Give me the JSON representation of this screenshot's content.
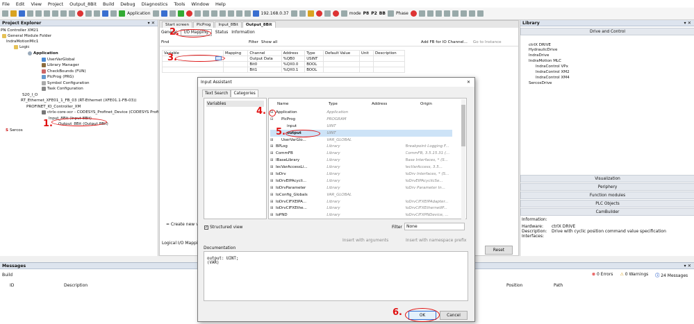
{
  "menu": [
    "File",
    "Edit",
    "View",
    "Project",
    "Output_8Bit",
    "Build",
    "Debug",
    "Diagnostics",
    "Tools",
    "Window",
    "Help"
  ],
  "toolbar": {
    "application": "Application",
    "ip": "192.168.0.37",
    "mode": "mode",
    "p8": "P8",
    "p2": "P2",
    "bb": "BB",
    "phase": "Phase"
  },
  "project_explorer": {
    "title": "Project Explorer",
    "items": [
      "PN Controller XM21",
      "General Module Folder",
      "IndraMotionMlc1",
      "Logic",
      "Application",
      "UserVarGlobal",
      "Library Manager",
      "CheckBounds (FUN)",
      "PlcProg (PRG)",
      "Symbol Configuration",
      "Task Configuration",
      "S20_I_O",
      "RT_Ethernet_XFE01_1_FB_03 (RT-Ethernet (XFE01.1-FB-03))",
      "PROFINET_IO_Controller_XM",
      "ctrlx-core-xcr - CODESYS_Profinet_Device (CODESYS Profinet",
      "Input_8Bit (Input 8Bit)",
      "Output_8Bit (Output 8Bit)",
      "Sercos"
    ]
  },
  "editor": {
    "tabs": [
      "Start screen",
      "PlcProg",
      "Input_8Bit",
      "Output_8Bit"
    ],
    "subtabs": [
      "General",
      "I/O Mapping",
      "Status",
      "Information"
    ],
    "find": "Find",
    "filter_label": "Filter",
    "filter_value": "Show all",
    "add_fb": "Add FB for IO Channel...",
    "goto": "Go to Instance",
    "columns": [
      "Variable",
      "Mapping",
      "Channel",
      "Address",
      "Type",
      "Default Value",
      "Unit",
      "Description"
    ],
    "rows": [
      [
        "Output Data",
        "%QB0",
        "USINT"
      ],
      [
        "Bit0",
        "%QX0.0",
        "BOOL"
      ],
      [
        "Bit1",
        "%QX0.1",
        "BOOL"
      ]
    ],
    "create_new": "= Create new va",
    "logical_mapping": "Logical I/O Mapping",
    "reset": "Reset"
  },
  "library": {
    "title": "Library",
    "drive_control": "Drive and Control",
    "items": [
      "ctrlX DRIVE",
      "HydraulicDrive",
      "IndraDrive",
      "IndraMotion MLC",
      "IndraControl VPx",
      "IndraControl XM2",
      "IndraControl XM4",
      "SercosDrive"
    ],
    "categories": [
      "Visualization",
      "Periphery",
      "Function modules",
      "PLC Objects",
      "CamBuilder"
    ],
    "info_label": "Information:",
    "hardware_label": "Hardware:",
    "hardware": "ctrlX DRIVE",
    "desc_label": "Description:",
    "desc": "Drive with cyclic position command value specification",
    "interfaces_label": "Interfaces:"
  },
  "messages": {
    "title": "Messages",
    "build": "Build",
    "errors": "0 Errors",
    "warnings": "0 Warnings",
    "msgs": "24 Messages",
    "cols": [
      "ID",
      "Description",
      "Position",
      "Path"
    ]
  },
  "dialog": {
    "title": "Input Assistant",
    "tabs": [
      "Text Search",
      "Categories"
    ],
    "left_item": "Variables",
    "cols": [
      "Name",
      "Type",
      "Address",
      "Origin"
    ],
    "rows": [
      [
        "Application",
        "Application",
        "",
        ""
      ],
      [
        "PlcProg",
        "PROGRAM",
        "",
        ""
      ],
      [
        "input",
        "UINT",
        "",
        ""
      ],
      [
        "output",
        "UINT",
        "",
        ""
      ],
      [
        "UserVarGlo...",
        "VAR_GLOBAL",
        "",
        ""
      ],
      [
        "BPLog",
        "Library",
        "",
        "Breakpoint Logging F..."
      ],
      [
        "CommFB",
        "Library",
        "",
        "CommFB, 3.5.15.31 (..."
      ],
      [
        "IBaseLibrary",
        "Library",
        "",
        "Base Interfaces, * (S..."
      ],
      [
        "IecVarAccessLi...",
        "Library",
        "",
        "IecVarAccess, 3.5..."
      ],
      [
        "IoDrv",
        "Library",
        "",
        "IoDrv Interfaces, * (S..."
      ],
      [
        "IoDrvEIPAcycli...",
        "Library",
        "",
        "IoDrvEIPAcyclicSe..."
      ],
      [
        "IoDrvParameter",
        "Library",
        "",
        "IoDrv Parameter In..."
      ],
      [
        "IoConfig_Globals",
        "VAR_GLOBAL",
        "",
        ""
      ],
      [
        "IoDrvCIFXEIPA...",
        "Library",
        "",
        "IoDrvCIFXEIPAdapter..."
      ],
      [
        "IoDrvCIFXEthe...",
        "Library",
        "",
        "IoDrvCIFXEthernetIP..."
      ],
      [
        "IoPND",
        "Library",
        "",
        "IoDrvCIFXPNDevice, ..."
      ]
    ],
    "structured": "Structured view",
    "filter_label": "Filter",
    "filter_value": "None",
    "insert_args": "Insert with arguments",
    "insert_ns": "Insert with namespace prefix",
    "doc_label": "Documentation",
    "doc_line1": "output: UINT;",
    "doc_line2": "(VAR)",
    "ok": "OK",
    "cancel": "Cancel"
  },
  "annotations": [
    "1.",
    "2.",
    "3.",
    "4.",
    "5.",
    "6."
  ]
}
